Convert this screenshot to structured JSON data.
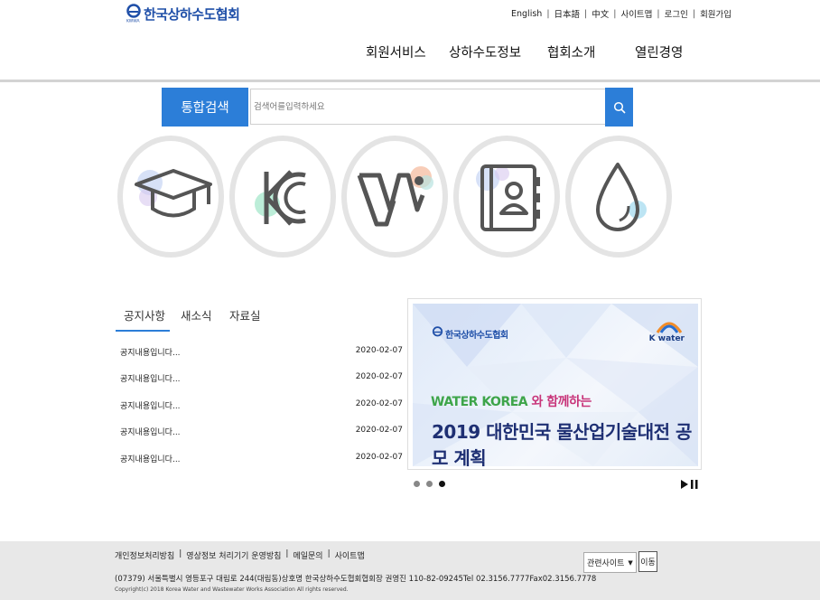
{
  "header": {
    "logo_text": "한국상하수도협회",
    "util_links": [
      "English",
      "日本語",
      "中文",
      "사이트맵",
      "로그인",
      "회원가입"
    ],
    "gnb": [
      "회원서비스",
      "상하수도정보",
      "협회소개",
      "열린경영"
    ]
  },
  "search": {
    "label": "통합검색",
    "placeholder": "검색어를입력하세요",
    "icon": "search-icon"
  },
  "quick_links": [
    {
      "icon": "graduation-cap-icon"
    },
    {
      "icon": "kc-mark-icon"
    },
    {
      "icon": "w-logo-icon"
    },
    {
      "icon": "address-book-icon"
    },
    {
      "icon": "water-drop-icon"
    }
  ],
  "board": {
    "tabs": [
      "공지사항",
      "새소식",
      "자료실"
    ],
    "active_tab": "공지사항",
    "rows": [
      {
        "title": "공지내용입니다...",
        "date": "2020-02-07"
      },
      {
        "title": "공지내용입니다...",
        "date": "2020-02-07"
      },
      {
        "title": "공지내용입니다...",
        "date": "2020-02-07"
      },
      {
        "title": "공지내용입니다...",
        "date": "2020-02-07"
      },
      {
        "title": "공지내용입니다...",
        "date": "2020-02-07"
      }
    ]
  },
  "banner": {
    "logo_text": "한국상하수도협회",
    "partner": "K water",
    "line1_green": "WATER KOREA",
    "line1_rest": " 와 함께하는",
    "line2": "2019 대한민국 물산업기술대전 공모 계획",
    "slides_total": 3,
    "active_slide": 3
  },
  "footer": {
    "links": [
      "개인정보처리방침",
      "영상정보 처리기기 운영방침",
      "메일문의",
      "사이트맵"
    ],
    "address": "(07379) 서울특별시 영등포구 대림로 244(대림동)상호명 한국상하수도협회협회장 권영진 110-82-09245Tel 02.3156.7777Fax02.3156.7778",
    "copyright": "Copyright(c) 2018 Korea Water and Wastewater Works Association All rights reserved.",
    "related_select": "관련사이트",
    "go_label": "이동"
  },
  "colors": {
    "primary": "#2c7ed8",
    "logo": "#1f4fa8",
    "footer_bg": "#e8e8e8"
  }
}
